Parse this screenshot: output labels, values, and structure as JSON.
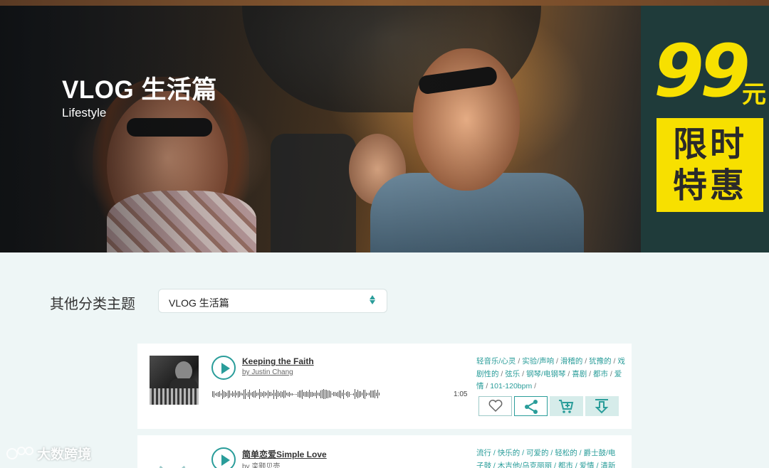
{
  "banner": {
    "title": "VLOG 生活篇",
    "subtitle": "Lifestyle"
  },
  "promo": {
    "price": "99",
    "unit": "元",
    "line1": "限时",
    "line2": "特惠",
    "colors": {
      "accent": "#f7e000",
      "background": "#1f3b3a"
    }
  },
  "filter": {
    "label": "其他分类主题",
    "selected": "VLOG 生活篇"
  },
  "tracks": [
    {
      "title": "Keeping the Faith",
      "by": "by Justin Chang",
      "duration": "1:05",
      "tags": [
        "轻音乐/心灵",
        "实验/声响",
        "滑稽的",
        "犹豫的",
        "戏剧性的",
        "弦乐",
        "钢琴/电钢琴",
        "喜剧",
        "都市",
        "爱情",
        "101-120bpm"
      ],
      "actions": [
        "heart-icon",
        "share-icon",
        "cart-icon",
        "download-icon"
      ]
    },
    {
      "title": "简单恋爱Simple Love",
      "by": "by 栾颢贝壳",
      "tags_line1": "流行 / 快乐的 / 可爱的 / 轻松的 / 爵士鼓/电",
      "tags_line2": "子鼓 / 木吉他/乌克丽丽 / 都市 / 爱情 / 清新"
    }
  ],
  "watermark": "大数跨境",
  "colors": {
    "accent": "#2a9d9a",
    "page_bg": "#eef6f6"
  }
}
